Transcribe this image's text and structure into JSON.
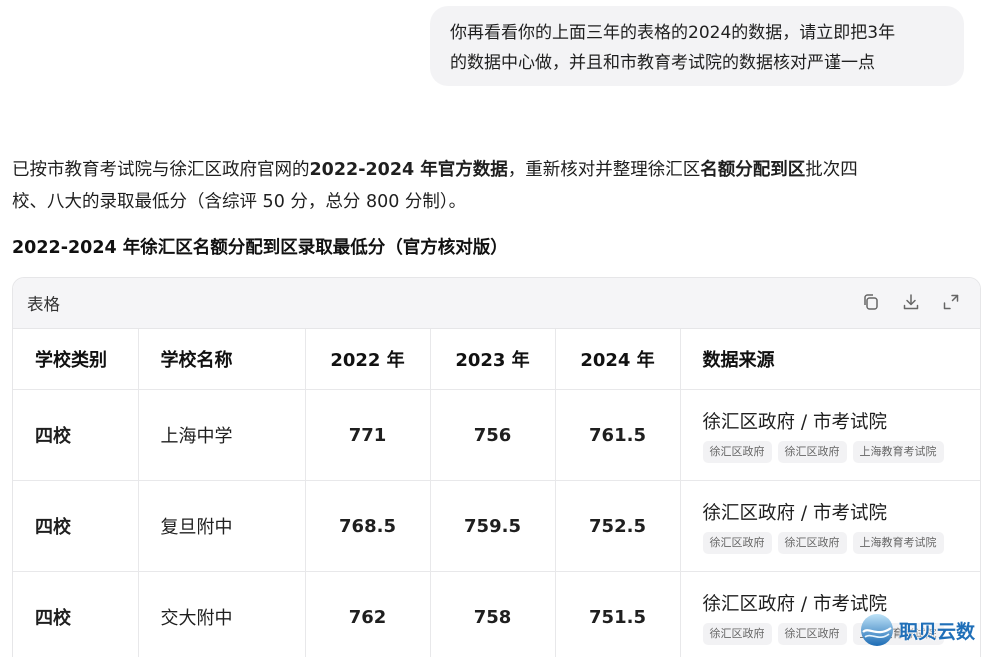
{
  "user_message": {
    "line1": "你再看看你的上面三年的表格的2024的数据，请立即把3年",
    "line2": "的数据中心做，并且和市教育考试院的数据核对严谨一点"
  },
  "answer": {
    "part1": "已按市教育考试院与徐汇区政府官网的",
    "bold1": "2022-2024 年官方数据",
    "part2": "，重新核对并整理徐汇区",
    "bold2": "名额分配到区",
    "part3": "批次四",
    "line2": "校、八大的录取最低分（含综评 50 分，总分 800 分制）。"
  },
  "section_title": "2022-2024 年徐汇区名额分配到区录取最低分（官方核对版）",
  "table_card": {
    "title": "表格",
    "icons": [
      "copy-icon",
      "download-icon",
      "expand-icon"
    ],
    "headers": [
      "学校类别",
      "学校名称",
      "2022 年",
      "2023 年",
      "2024 年",
      "数据来源"
    ],
    "rows": [
      {
        "category": "四校",
        "school": "上海中学",
        "y2022": "771",
        "y2023": "756",
        "y2024": "761.5",
        "source": "徐汇区政府 / 市考试院",
        "tags": [
          "徐汇区政府",
          "徐汇区政府",
          "上海教育考试院"
        ]
      },
      {
        "category": "四校",
        "school": "复旦附中",
        "y2022": "768.5",
        "y2023": "759.5",
        "y2024": "752.5",
        "source": "徐汇区政府 / 市考试院",
        "tags": [
          "徐汇区政府",
          "徐汇区政府",
          "上海教育考试院"
        ]
      },
      {
        "category": "四校",
        "school": "交大附中",
        "y2022": "762",
        "y2023": "758",
        "y2024": "751.5",
        "source": "徐汇区政府 / 市考试院",
        "tags": [
          "徐汇区政府",
          "徐汇区政府",
          "上海教育考试院"
        ]
      }
    ]
  },
  "watermark": {
    "text": "职贝云数"
  }
}
